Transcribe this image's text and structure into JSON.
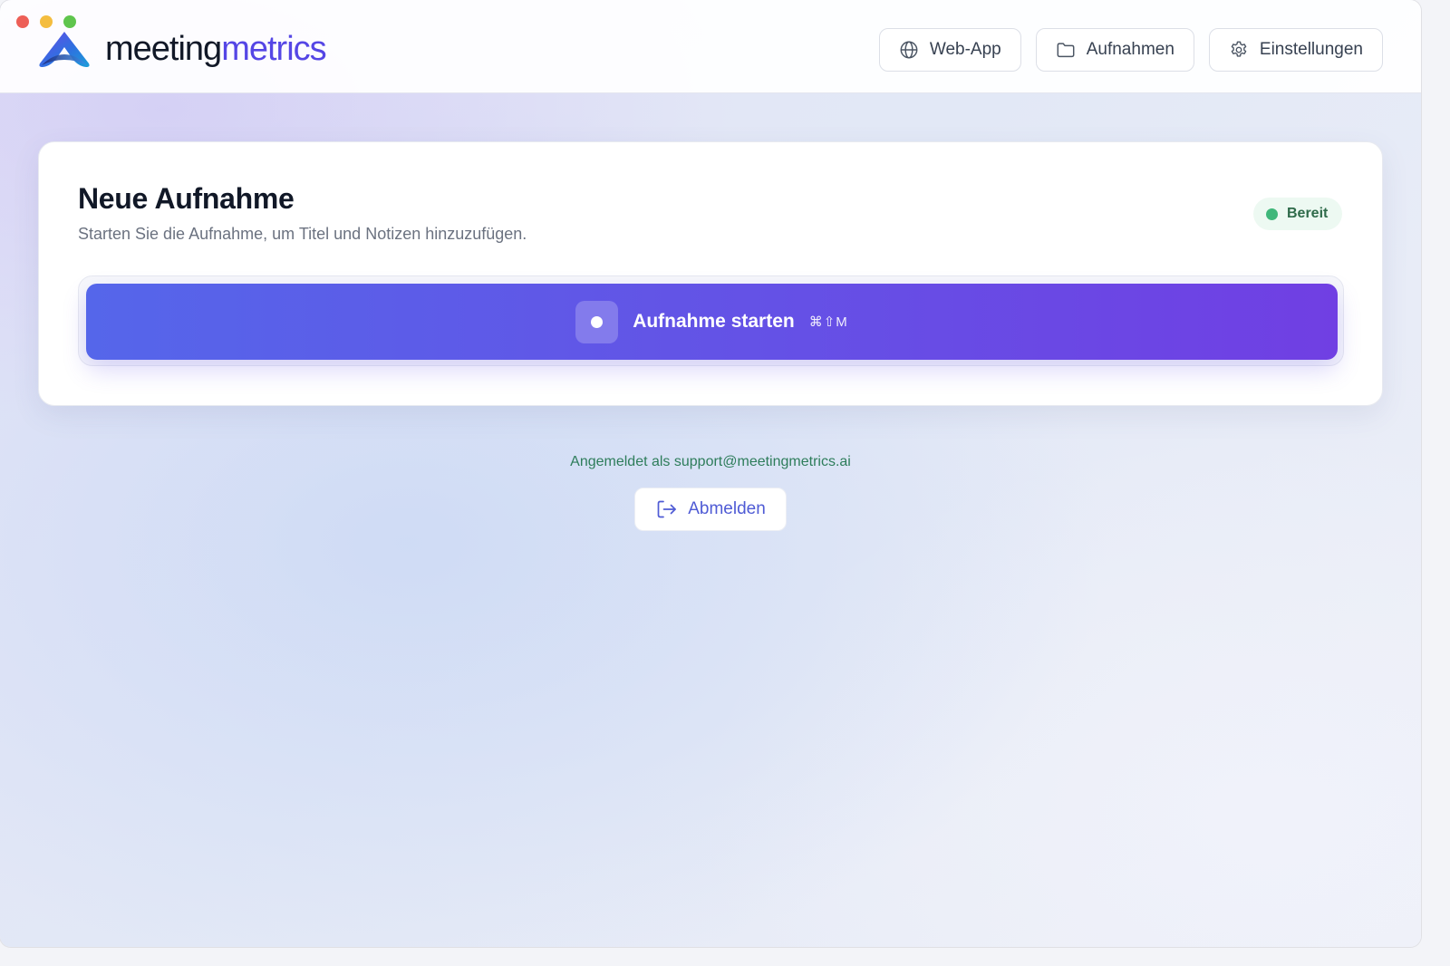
{
  "app": {
    "logo_part1": "meeting",
    "logo_part2": "metrics",
    "brand_color": "#5546e5"
  },
  "nav": {
    "web_app": {
      "label": "Web-App",
      "icon": "globe-icon"
    },
    "recordings": {
      "label": "Aufnahmen",
      "icon": "folder-icon"
    },
    "settings": {
      "label": "Einstellungen",
      "icon": "gear-icon"
    }
  },
  "card": {
    "title": "Neue Aufnahme",
    "subtitle": "Starten Sie die Aufnahme, um Titel und Notizen hinzuzufügen.",
    "status": {
      "label": "Bereit",
      "color": "#3fb77a"
    },
    "record_button": {
      "label": "Aufnahme starten",
      "shortcut": "⌘⇧M",
      "icon": "record-dot-icon"
    }
  },
  "account": {
    "signed_in_text": "Angemeldet als support@meetingmetrics.ai",
    "logout_label": "Abmelden",
    "logout_icon": "logout-icon"
  }
}
